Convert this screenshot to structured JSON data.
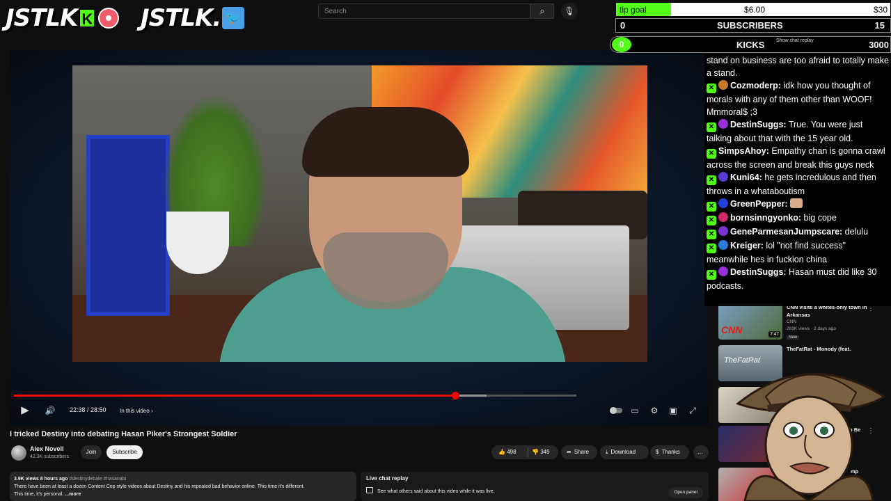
{
  "branding": {
    "logo_kick": "JSTLK",
    "logo_kick_icon": "K",
    "logo_twitter": "JSTLK.",
    "twitter_icon": "twitter-bird-icon",
    "record_icon": "record-icon"
  },
  "search": {
    "placeholder": "Search"
  },
  "video": {
    "title": "I tricked Destiny into debating Hasan Piker's Strongest Soldier",
    "time_display": "22:38 / 28:50",
    "in_this_video": "In this video",
    "progress_fraction": 0.785,
    "buffer_fraction": 0.84
  },
  "channel": {
    "name": "Alex Novell",
    "subscribers": "42.3K subscribers",
    "join_label": "Join",
    "subscribe_label": "Subscribe"
  },
  "actions": {
    "likes": "498",
    "dislikes": "349",
    "share": "Share",
    "download": "Download",
    "thanks": "Thanks",
    "more": "…"
  },
  "description": {
    "stats": "3.9K views  8 hours ago",
    "tags": "#destinydebate #hasanabi",
    "line1": "There have been at least a dozen Content Cop style videos about Destiny and his repeated bad behavior online. This time it's different.",
    "line2": "This time, it's personal.",
    "more": "...more"
  },
  "live_chat_replay": {
    "title": "Live chat replay",
    "subtitle": "See what others said about this video while it was live.",
    "open_panel": "Open panel"
  },
  "overlay": {
    "tip_goal": {
      "label": "tip goal",
      "current": "$6.00",
      "goal": "$30",
      "fill_fraction": 0.2
    },
    "subscribers": {
      "current": "0",
      "label": "SUBSCRIBERS",
      "goal": "15"
    },
    "kicks": {
      "current": "0",
      "label": "KICKS",
      "show_chat_replay": "Show chat replay",
      "goal": "3000"
    }
  },
  "chat": {
    "lead": "stand on business are too afraid to totally make a stand.",
    "messages": [
      {
        "user": "Cozmoderp:",
        "text": " idk how you thought of morals with any of them other than WOOF! Mmmoral$ ;3",
        "badge_color": "#c67a2c"
      },
      {
        "user": "DestinSuggs:",
        "text": " True. You were just talking about that with the 15 year old.",
        "badge_color": "#9b30d9"
      },
      {
        "user": "SimpsAhoy:",
        "text": " Empathy chan is gonna crawl across the screen and break this guys neck",
        "badge_color": ""
      },
      {
        "user": "Kuni64:",
        "text": " he gets incredulous and then throws in a whataboutism",
        "badge_color": "#5b3bd6"
      },
      {
        "user": "GreenPepper:",
        "text": " ",
        "badge_color": "#2540d8"
      },
      {
        "user": "bornsinngyonko:",
        "text": " big cope",
        "badge_color": "#d12a6a"
      },
      {
        "user": "GeneParmesanJumpscare:",
        "text": " delulu",
        "badge_color": "#7a34d1"
      },
      {
        "user": "Kreiger:",
        "text": " lol \"not find success\" meanwhile hes in fuckion china",
        "badge_color": "#2a7ad8"
      },
      {
        "user": "DestinSuggs:",
        "text": " Hasan must did like 30 podcasts.",
        "badge_color": "#9b30d9"
      }
    ]
  },
  "recommendations": [
    {
      "title": "CNN visits a whites-only town in Arkansas",
      "channel": "CNN",
      "meta": "283K views · 2 days ago",
      "badge": "New",
      "duration": "7:47"
    },
    {
      "title": "TheFatRat - Monody (feat.",
      "channel": "",
      "meta": "",
      "badge": "",
      "duration": ""
    },
    {
      "title": "",
      "channel": "",
      "meta": "",
      "badge": "",
      "duration": ""
    },
    {
      "title": "To Be",
      "channel": "",
      "meta": "",
      "badge": "",
      "duration": ""
    },
    {
      "title": "mp",
      "channel": "",
      "meta": "",
      "badge": "",
      "duration": ""
    }
  ],
  "icons": {
    "play": "play-icon",
    "volume": "volume-icon",
    "settings": "gear-icon",
    "fullscreen": "fullscreen-icon",
    "miniplayer": "miniplayer-icon",
    "subtitles": "subtitles-icon",
    "search": "search-icon",
    "mic": "mic-icon"
  },
  "colors": {
    "kick_green": "#53fc18",
    "youtube_red": "#ff0000"
  }
}
